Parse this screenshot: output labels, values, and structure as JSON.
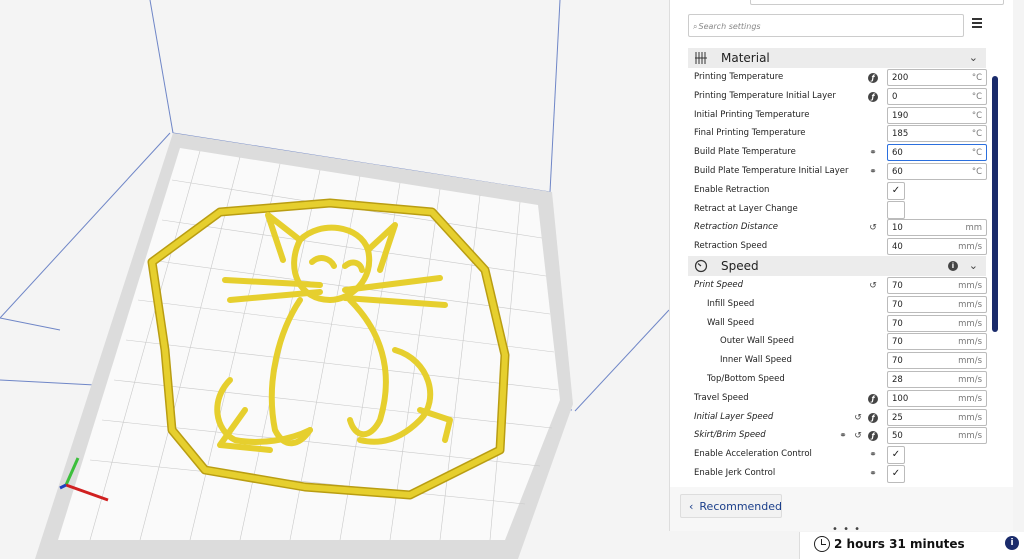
{
  "search": {
    "placeholder": "Search settings"
  },
  "categories": {
    "material": {
      "label": "Material",
      "icon": "material-spool-icon"
    },
    "speed": {
      "label": "Speed",
      "icon": "speedometer-icon"
    }
  },
  "material_settings": [
    {
      "label": "Printing Temperature",
      "value": "200",
      "unit": "°C",
      "icons": [
        "function-icon"
      ]
    },
    {
      "label": "Printing Temperature Initial Layer",
      "value": "0",
      "unit": "°C",
      "icons": [
        "function-icon"
      ]
    },
    {
      "label": "Initial Printing Temperature",
      "value": "190",
      "unit": "°C",
      "icons": []
    },
    {
      "label": "Final Printing Temperature",
      "value": "185",
      "unit": "°C",
      "icons": []
    },
    {
      "label": "Build Plate Temperature",
      "value": "60",
      "unit": "°C",
      "icons": [
        "link-icon"
      ],
      "active": true
    },
    {
      "label": "Build Plate Temperature Initial Layer",
      "value": "60",
      "unit": "°C",
      "icons": [
        "link-icon"
      ]
    },
    {
      "label": "Enable Retraction",
      "checked": true,
      "icons": []
    },
    {
      "label": "Retract at Layer Change",
      "checked": false,
      "icons": []
    },
    {
      "label": "Retraction Distance",
      "value": "10",
      "unit": "mm",
      "icons": [
        "reset-icon"
      ],
      "italic": true
    },
    {
      "label": "Retraction Speed",
      "value": "40",
      "unit": "mm/s",
      "icons": []
    }
  ],
  "speed_settings": [
    {
      "label": "Print Speed",
      "value": "70",
      "unit": "mm/s",
      "indent": 0,
      "icons": [
        "reset-icon"
      ],
      "italic": true
    },
    {
      "label": "Infill Speed",
      "value": "70",
      "unit": "mm/s",
      "indent": 1,
      "icons": []
    },
    {
      "label": "Wall Speed",
      "value": "70",
      "unit": "mm/s",
      "indent": 1,
      "icons": []
    },
    {
      "label": "Outer Wall Speed",
      "value": "70",
      "unit": "mm/s",
      "indent": 2,
      "icons": []
    },
    {
      "label": "Inner Wall Speed",
      "value": "70",
      "unit": "mm/s",
      "indent": 2,
      "icons": []
    },
    {
      "label": "Top/Bottom Speed",
      "value": "28",
      "unit": "mm/s",
      "indent": 1,
      "icons": []
    },
    {
      "label": "Travel Speed",
      "value": "100",
      "unit": "mm/s",
      "indent": 0,
      "icons": [
        "function-icon"
      ]
    },
    {
      "label": "Initial Layer Speed",
      "value": "25",
      "unit": "mm/s",
      "indent": 0,
      "icons": [
        "reset-icon",
        "function-icon"
      ],
      "italic": true
    },
    {
      "label": "Skirt/Brim Speed",
      "value": "50",
      "unit": "mm/s",
      "indent": 0,
      "icons": [
        "link-icon",
        "reset-icon",
        "function-icon"
      ],
      "italic": true
    },
    {
      "label": "Enable Acceleration Control",
      "checked": true,
      "indent": 0,
      "icons": [
        "link-icon"
      ]
    },
    {
      "label": "Enable Jerk Control",
      "checked": true,
      "indent": 0,
      "icons": [
        "link-icon"
      ]
    }
  ],
  "footer": {
    "recommended_label": "Recommended",
    "estimate_time": "2 hours 31 minutes"
  },
  "colors": {
    "accent": "#1a2b6b",
    "model": "#e6cf2e",
    "plate": "#dcdcdc"
  }
}
